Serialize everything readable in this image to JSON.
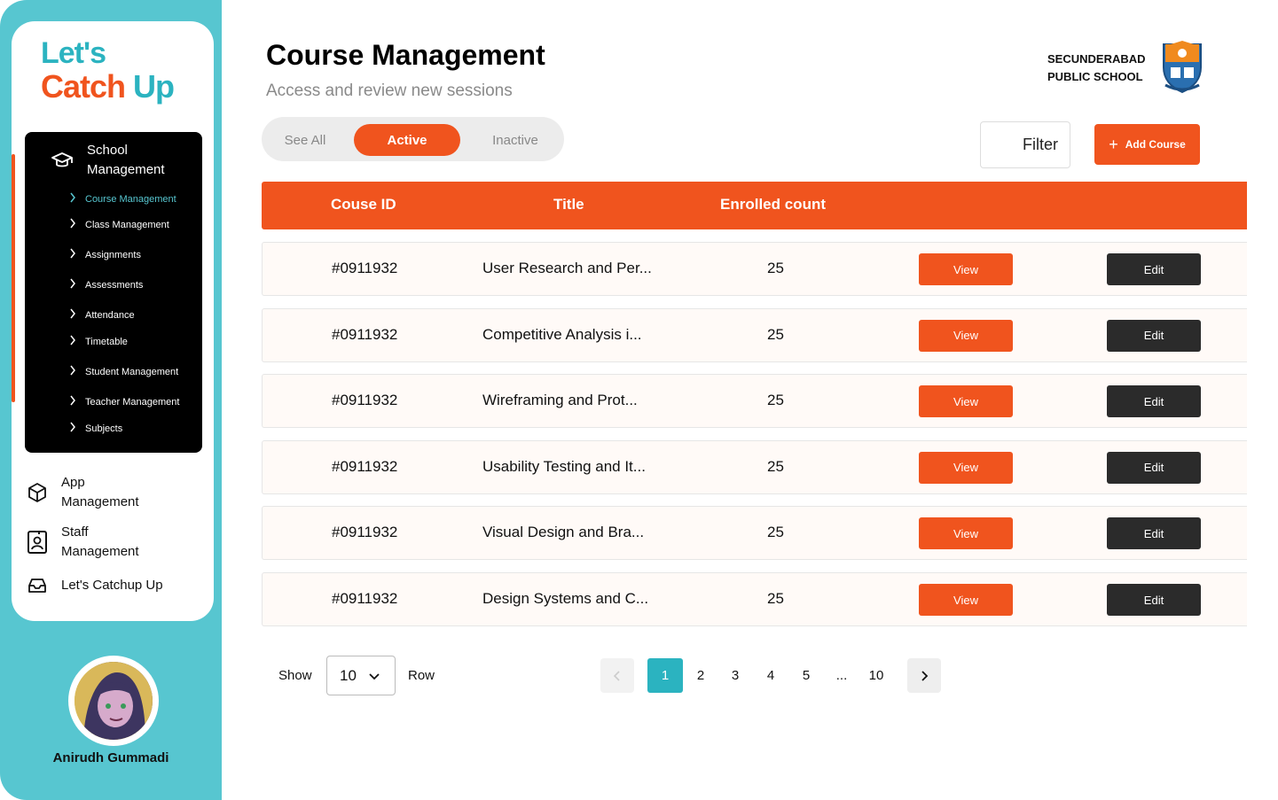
{
  "brand": {
    "line1": "Let's",
    "line2a": "Catch ",
    "line2b": "Up"
  },
  "sidebar": {
    "school_section": "School Management",
    "sub_items": [
      {
        "label": "Course Management",
        "active": true
      },
      {
        "label": "Class Management"
      },
      {
        "label": "Assignments"
      },
      {
        "label": "Assessments"
      },
      {
        "label": "Attendance"
      },
      {
        "label": "Timetable"
      },
      {
        "label": "Student Management"
      },
      {
        "label": "Teacher Management"
      },
      {
        "label": "Subjects"
      }
    ],
    "main_items": [
      {
        "label": "App Management",
        "icon": "box-icon"
      },
      {
        "label": "Staff Management",
        "icon": "id-badge-icon"
      },
      {
        "label": "Let's Catchup Up",
        "icon": "inbox-icon"
      }
    ],
    "user_name": "Anirudh Gummadi"
  },
  "header": {
    "title": "Course Management",
    "subtitle": "Access and review new sessions",
    "school_line1": "SECUNDERABAD",
    "school_line2": "PUBLIC SCHOOL"
  },
  "tabs": [
    {
      "label": "See All"
    },
    {
      "label": "Active",
      "active": true
    },
    {
      "label": "Inactive"
    }
  ],
  "toolbar": {
    "filter_label": "Filter",
    "add_label": "Add Course"
  },
  "table": {
    "columns": [
      "Couse ID",
      "Title",
      "Enrolled count"
    ],
    "view_label": "View",
    "edit_label": "Edit",
    "rows": [
      {
        "id": "#0911932",
        "title": "User Research and Per...",
        "enrolled": "25"
      },
      {
        "id": "#0911932",
        "title": "Competitive Analysis i...",
        "enrolled": "25"
      },
      {
        "id": "#0911932",
        "title": "Wireframing and Prot...",
        "enrolled": "25"
      },
      {
        "id": "#0911932",
        "title": "Usability Testing and It...",
        "enrolled": "25"
      },
      {
        "id": "#0911932",
        "title": "Visual Design and Bra...",
        "enrolled": "25"
      },
      {
        "id": "#0911932",
        "title": "Design Systems and C...",
        "enrolled": "25"
      }
    ]
  },
  "pagination": {
    "show_label": "Show",
    "rows_value": "10",
    "row_label": "Row",
    "pages": [
      "1",
      "2",
      "3",
      "4",
      "5",
      "...",
      "10"
    ],
    "current": "1"
  },
  "colors": {
    "accent": "#F0541E",
    "teal": "#57C6D0",
    "dark": "#2b2b2b"
  }
}
